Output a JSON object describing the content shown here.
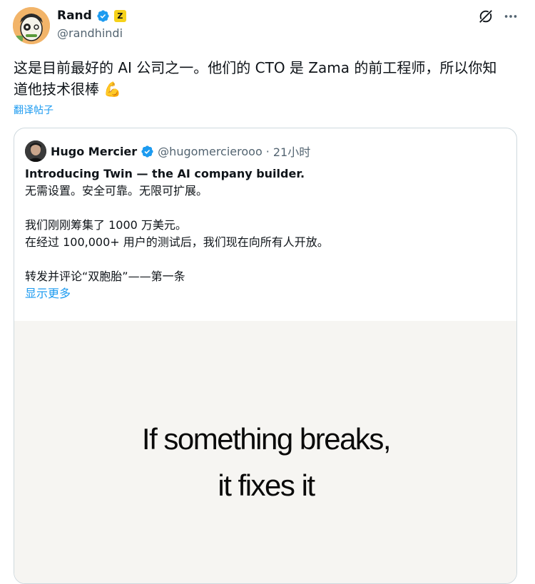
{
  "author": {
    "name": "Rand",
    "badge_letter": "Z",
    "handle": "@randhindi"
  },
  "tweet": {
    "text_line1": "这是目前最好的 AI 公司之一。他们的 CTO 是 Zama 的前工程师，所以你知",
    "text_line2": "道他技术很棒",
    "emoji": "💪",
    "translate_label": "翻译帖子"
  },
  "quote": {
    "name": "Hugo Mercier",
    "handle": "@hugomercierooo",
    "separator": "·",
    "time": "21小时",
    "line1": "Introducing Twin — the AI company builder.",
    "line2": "无需设置。安全可靠。无限可扩展。",
    "line3": "我们刚刚筹集了 1000 万美元。",
    "line4": "在经过 100,000+ 用户的测试后，我们现在向所有人开放。",
    "line5": "转发并评论“双胞胎”——第一条",
    "show_more": "显示更多",
    "media_line1": "If something breaks,",
    "media_line2": "it fixes it"
  },
  "icons": {
    "verified": "verified-badge-icon",
    "grok": "grok-icon",
    "more": "more-icon"
  },
  "colors": {
    "accent": "#1d9bf0",
    "secondary_text": "#536471",
    "zbadge": "#f6d21a",
    "media_bg": "#f6f5f2"
  }
}
